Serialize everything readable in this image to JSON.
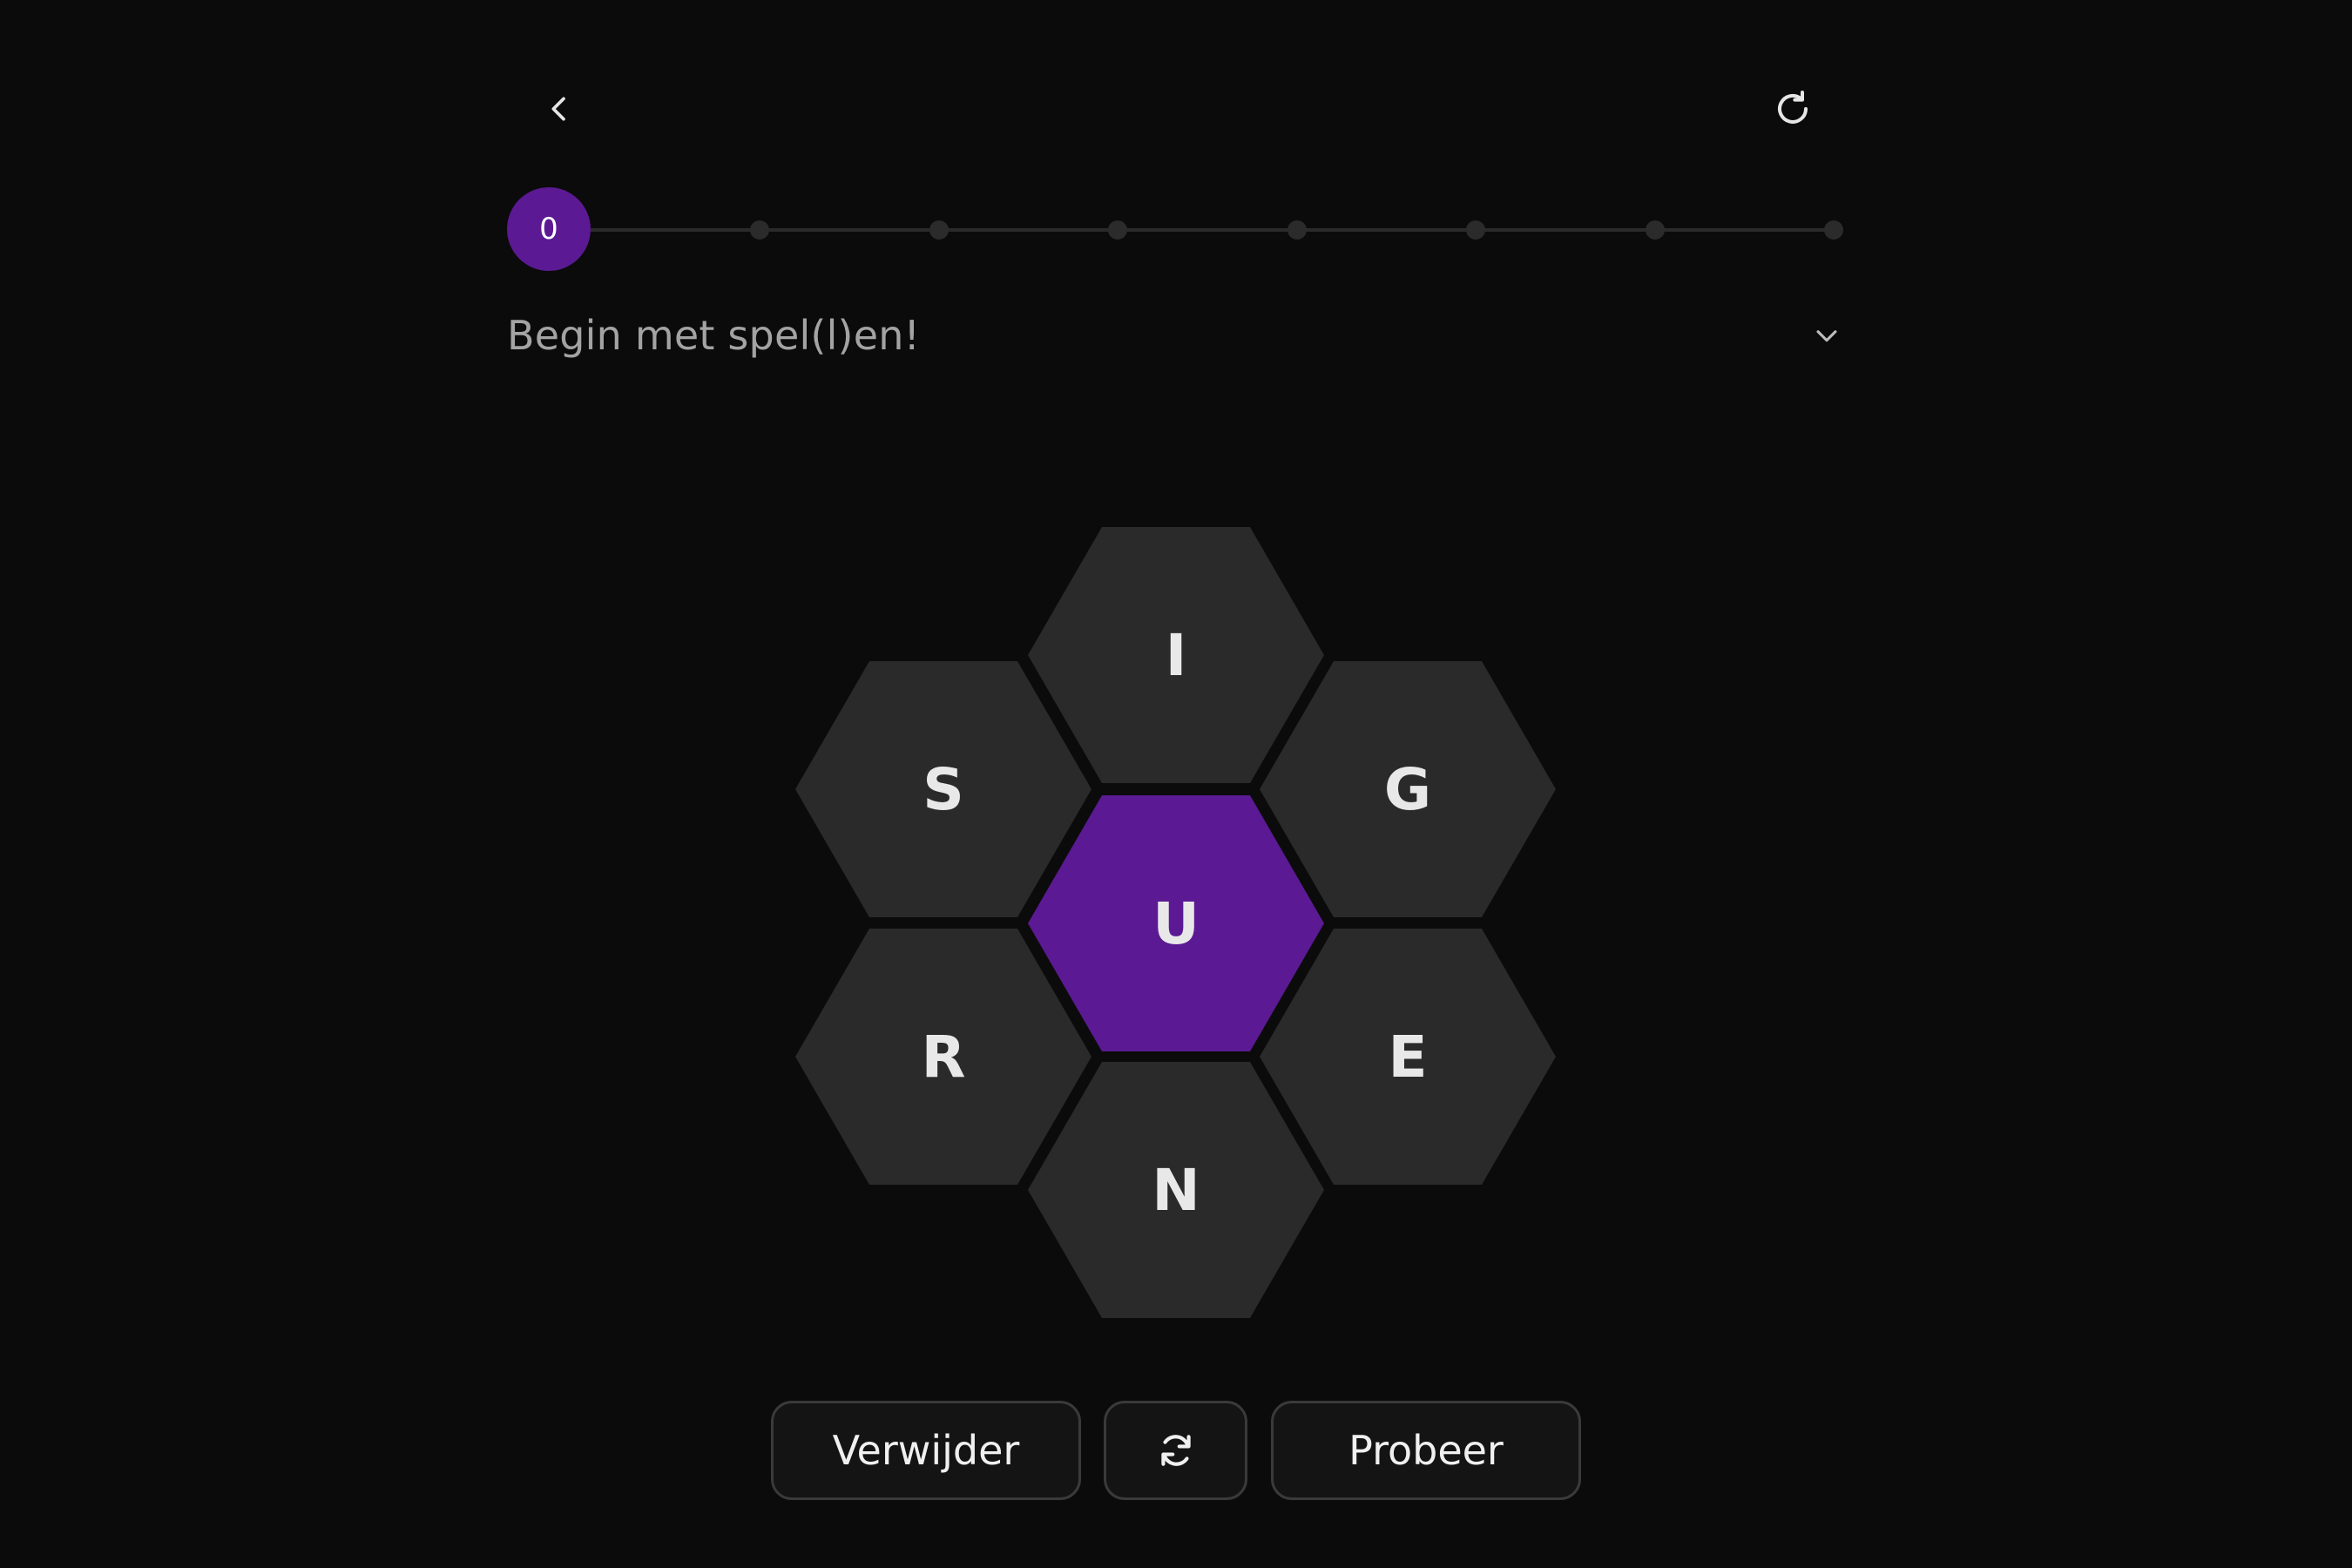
{
  "header": {
    "back_icon": "chevron-left-icon",
    "restart_icon": "refresh-icon"
  },
  "progress": {
    "score": "0",
    "levels_total": 9,
    "current_level": 0
  },
  "status": {
    "text": "Begin met spel(l)en!",
    "expand_icon": "chevron-down-icon"
  },
  "hive": {
    "center_letter": "U",
    "outer_letters": {
      "top": "I",
      "upper_left": "S",
      "upper_right": "G",
      "lower_left": "R",
      "lower_right": "E",
      "bottom": "N"
    }
  },
  "actions": {
    "delete_label": "Verwijder",
    "shuffle_icon": "shuffle-icon",
    "enter_label": "Probeer"
  },
  "colors": {
    "background": "#0b0b0b",
    "accent": "#5b1a93",
    "cell": "#2a2a2a",
    "text_muted": "#a3a3a3"
  }
}
